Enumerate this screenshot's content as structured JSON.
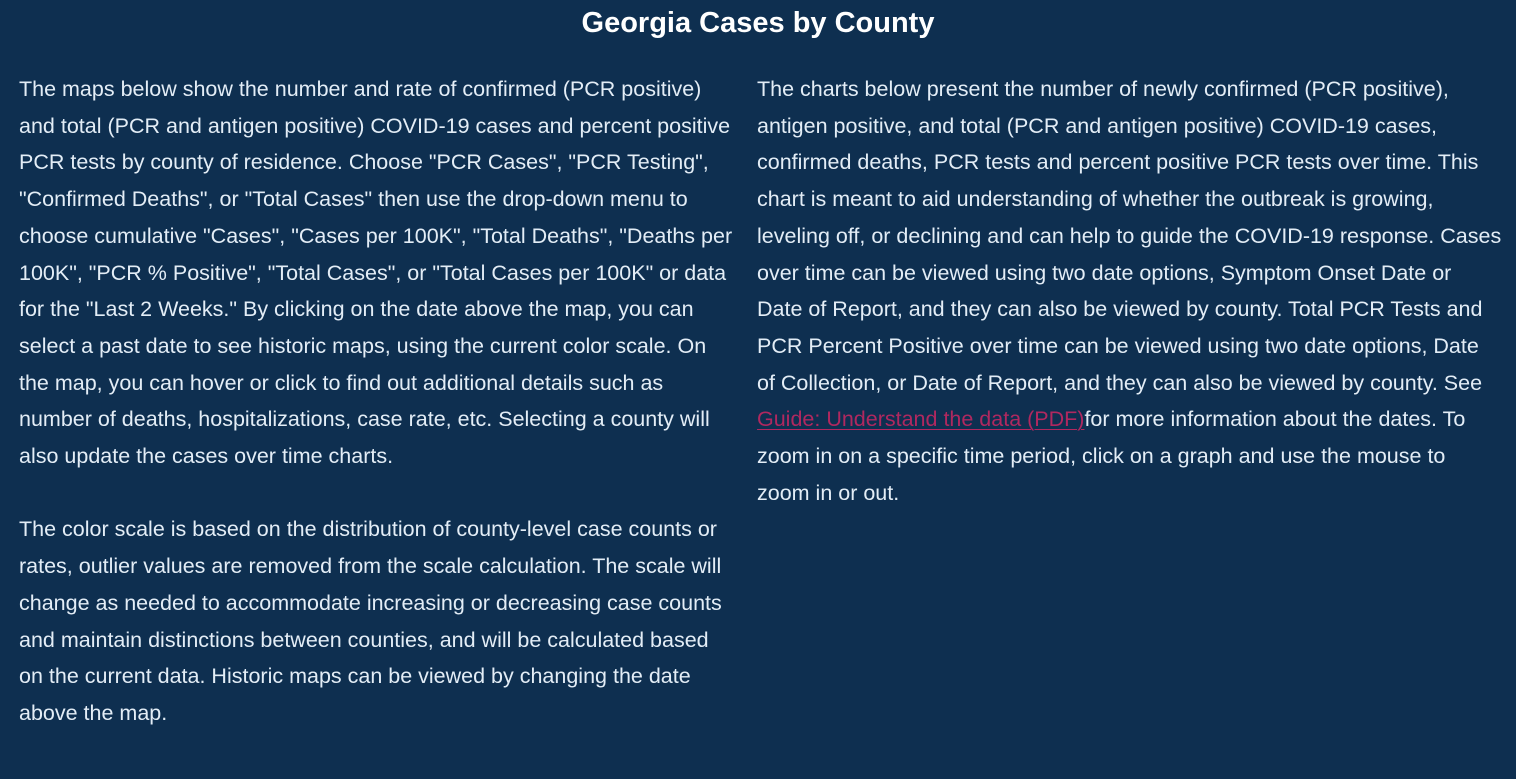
{
  "header": {
    "title": "Georgia Cases by County"
  },
  "left_column": {
    "paragraph_1": "The maps below show the number and rate of confirmed (PCR positive) and total (PCR and antigen positive) COVID-19 cases and percent positive PCR tests by county of residence. Choose \"PCR Cases\", \"PCR Testing\", \"Confirmed Deaths\", or \"Total Cases\" then use the drop-down menu to choose cumulative \"Cases\", \"Cases per 100K\", \"Total Deaths\", \"Deaths per 100K\", \"PCR % Positive\", \"Total Cases\", or \"Total Cases per 100K\" or data for the \"Last 2 Weeks.\" By clicking on the date above the map, you can select a past date to see historic maps, using the current color scale. On the map, you can hover or click to find out additional details such as number of deaths, hospitalizations, case rate, etc. Selecting a county will also update the cases over time charts.",
    "paragraph_2": "The color scale is based on the distribution of county-level case counts or rates, outlier values are removed from the scale calculation. The scale will change as needed to accommodate increasing or decreasing case counts and maintain distinctions between counties, and will be calculated based on the current data. Historic maps can be viewed by changing the date above the map."
  },
  "right_column": {
    "paragraph_before_link": "The charts below present the number of newly confirmed (PCR positive), antigen positive, and total (PCR and antigen positive) COVID-19 cases, confirmed deaths, PCR tests and percent positive PCR tests over time. This chart is meant to aid understanding of whether the outbreak is growing, leveling off, or declining and can help to guide the COVID-19 response. Cases over time can be viewed using two date options, Symptom Onset Date or Date of Report, and they can also be viewed by county. Total PCR Tests and PCR Percent Positive over time can be viewed using two date options, Date of Collection, or Date of Report, and they can also be viewed by county. See ",
    "link_text": "Guide: Understand the data (PDF)",
    "paragraph_after_link": "for more information about the dates. To zoom in on a specific time period, click on a graph and use the mouse to zoom in or out."
  },
  "colors": {
    "background": "#0e2f50",
    "text": "#e3edf6",
    "title": "#ffffff",
    "link": "#b0285f"
  }
}
